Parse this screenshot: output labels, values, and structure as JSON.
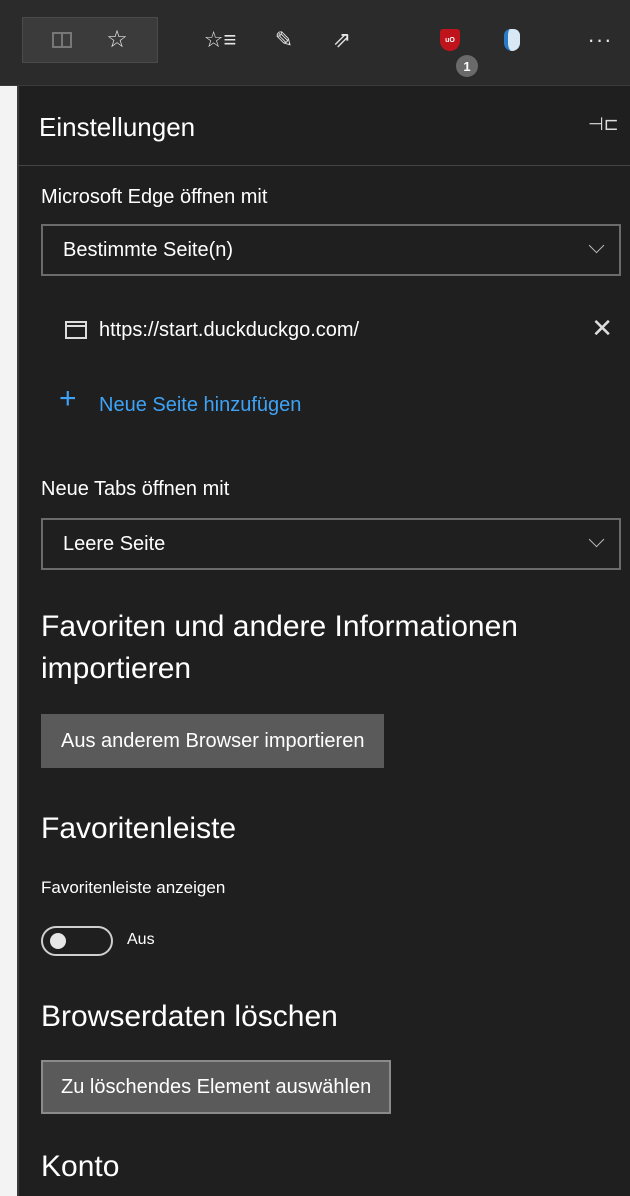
{
  "toolbar": {
    "icons": [
      "reading-view-icon",
      "star-icon",
      "favorites-list-icon",
      "pen-icon",
      "share-icon",
      "ublock-icon",
      "extension-shield-icon",
      "more-icon"
    ],
    "ublock_label": "uO",
    "ublock_badge": "1",
    "star_glyph": "☆",
    "favlist_glyph": "☆≡",
    "pen_glyph": "✎",
    "share_glyph": "⇗",
    "more_glyph": "···"
  },
  "panel": {
    "title": "Einstellungen",
    "pin_glyph": "⊣⊏",
    "startup": {
      "label": "Microsoft Edge öffnen mit",
      "selected": "Bestimmte Seite(n)",
      "pages": [
        "https://start.duckduckgo.com/"
      ],
      "add_page_label": "Neue Seite hinzufügen"
    },
    "new_tabs": {
      "label": "Neue Tabs öffnen mit",
      "selected": "Leere Seite"
    },
    "import": {
      "heading": "Favoriten und andere Informationen importieren",
      "button": "Aus anderem Browser importieren"
    },
    "favorites_bar": {
      "heading": "Favoritenleiste",
      "toggle_label": "Favoritenleiste anzeigen",
      "toggle_state": "Aus",
      "toggle_on": false
    },
    "clear_data": {
      "heading": "Browserdaten löschen",
      "button": "Zu löschendes Element auswählen"
    },
    "account": {
      "heading": "Konto"
    }
  },
  "colors": {
    "panel_bg": "#1f1f1f",
    "toolbar_bg": "#2b2b2b",
    "link_blue": "#3ea3f6",
    "button_bg": "#5a5a5a"
  }
}
